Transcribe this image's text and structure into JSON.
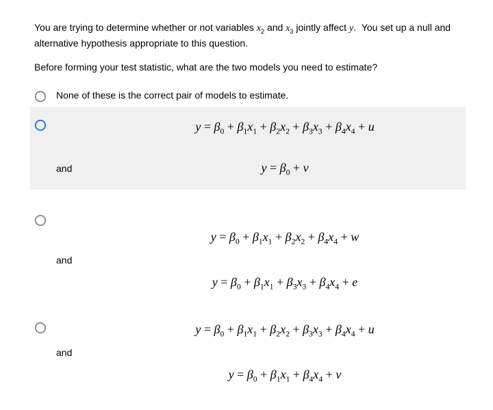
{
  "prompt": {
    "line1": "You are trying to determine whether or not variables x₂ and x₃ jointly affect y.  You set up a null and alternative hypothesis appropriate to this question.",
    "line2": "Before forming your test statistic, what are the two models you need to estimate?"
  },
  "options": {
    "none_label": "None of these is the correct pair of models to estimate.",
    "and_label": "and",
    "opt1": {
      "eq1": "y = β₀ + β₁x₁ + β₂x₂ + β₃x₃ + β₄x₄ + u",
      "eq2": "y = β₀ + v"
    },
    "opt2": {
      "eq1": "y = β₀ + β₁x₁ + β₂x₂ + β₄x₄ + w",
      "eq2": "y = β₀ + β₁x₁ + β₃x₃ + β₄x₄ + e"
    },
    "opt3": {
      "eq1": "y = β₀ + β₁x₁ + β₂x₂ + β₃x₃ + β₄x₄ + u",
      "eq2": "y = β₀ + β₁x₁ + β₄x₄ + v"
    }
  }
}
